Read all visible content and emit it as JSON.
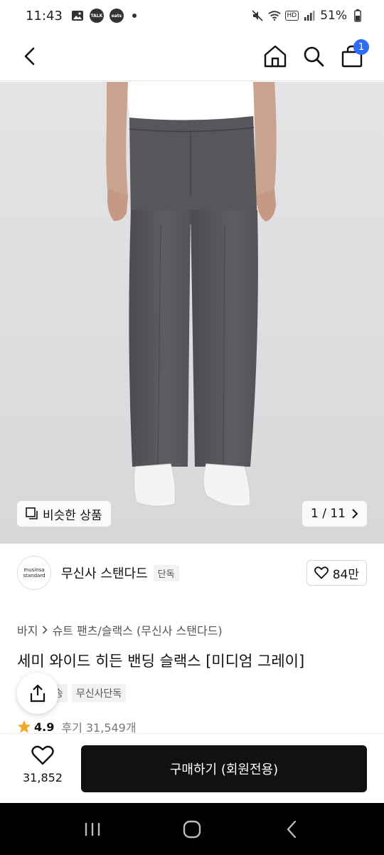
{
  "status_bar": {
    "time": "11:43",
    "talk_label": "TALK",
    "eats_label": "eats",
    "hd_label": "HD",
    "battery": "51%"
  },
  "header": {
    "cart_count": "1"
  },
  "image": {
    "similar_label": "비슷한 상품",
    "pager": "1 / 11"
  },
  "brand": {
    "logo_line1": "musinsa",
    "logo_line2": "standard",
    "name": "무신사 스탠다드",
    "tag": "단독",
    "likes": "84만"
  },
  "breadcrumb": {
    "root": "바지",
    "path": "슈트 팬츠/슬랙스 (무신사 스탠다드)"
  },
  "product": {
    "title": "세미 와이드 히든 밴딩 슬랙스 [미디엄 그레이]",
    "tags": [
      "송",
      "무신사단독"
    ],
    "rating": "4.9",
    "reviews": "후기 31,549개"
  },
  "bottom": {
    "wish_count": "31,852",
    "buy_label": "구매하기 (회원전용)"
  },
  "colors": {
    "accent": "#2d6cf6",
    "star": "#f5a623",
    "buy_button": "#111111",
    "image_bg": "#e2e2e4",
    "pants": "#5a5b5f"
  },
  "icons": [
    "back-arrow-icon",
    "home-icon",
    "search-icon",
    "shopping-bag-icon",
    "heart-icon",
    "share-icon",
    "star-icon",
    "chevron-right-icon",
    "similar-icon",
    "recents-icon",
    "home-circle-icon",
    "nav-back-icon"
  ]
}
